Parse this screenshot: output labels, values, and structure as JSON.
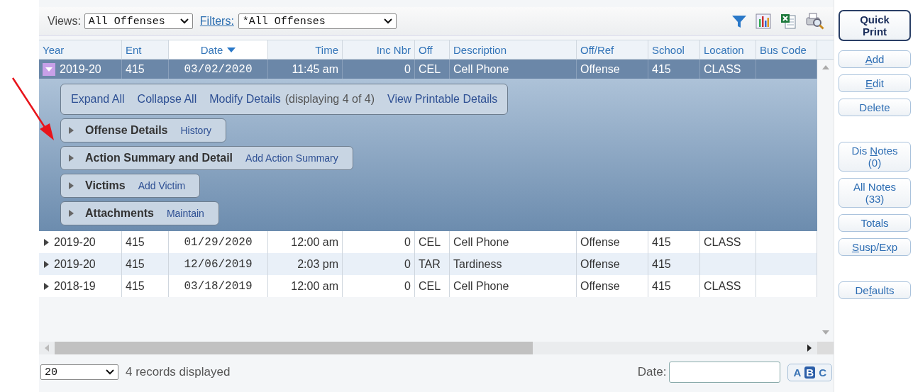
{
  "toolbar": {
    "views_label": "Views:",
    "views_value": "All Offenses",
    "filters_label": "Filters:",
    "filters_value": "*All Offenses"
  },
  "table": {
    "columns": [
      {
        "label": "Year",
        "sorted": false
      },
      {
        "label": "Ent",
        "sorted": false
      },
      {
        "label": "Date",
        "sorted": true
      },
      {
        "label": "Time",
        "sorted": false
      },
      {
        "label": "Inc Nbr",
        "sorted": false
      },
      {
        "label": "Off",
        "sorted": false
      },
      {
        "label": "Description",
        "sorted": false
      },
      {
        "label": "Off/Ref",
        "sorted": false
      },
      {
        "label": "School",
        "sorted": false
      },
      {
        "label": "Location",
        "sorted": false
      },
      {
        "label": "Bus Code",
        "sorted": false
      }
    ],
    "rows": [
      {
        "selected": true,
        "expanded": true,
        "cells": [
          "2019-20",
          "415",
          "03/02/2020",
          "11:45 am",
          "0",
          "CEL",
          "Cell Phone",
          "Offense",
          "415",
          "CLASS"
        ]
      },
      {
        "selected": false,
        "expanded": false,
        "cells": [
          "2019-20",
          "415",
          "01/29/2020",
          "12:00 am",
          "0",
          "CEL",
          "Cell Phone",
          "Offense",
          "415",
          "CLASS"
        ]
      },
      {
        "selected": false,
        "expanded": false,
        "cells": [
          "2019-20",
          "415",
          "12/06/2019",
          "2:03 pm",
          "0",
          "TAR",
          "Tardiness",
          "Offense",
          "415"
        ]
      },
      {
        "selected": false,
        "expanded": false,
        "cells": [
          "2018-19",
          "415",
          "03/18/2019",
          "12:00 am",
          "0",
          "CEL",
          "Cell Phone",
          "Offense",
          "415",
          "CLASS"
        ]
      }
    ],
    "details": {
      "links": [
        {
          "kind": "link",
          "text": "Expand All"
        },
        {
          "kind": "link",
          "text": "Collapse All"
        },
        {
          "kind": "link",
          "text": "Modify Details"
        },
        {
          "kind": "note",
          "text": "(displaying 4 of 4)"
        },
        {
          "kind": "link",
          "text": "View Printable Details"
        }
      ],
      "sections": [
        {
          "title": "Offense Details",
          "action": "History",
          "expanded": false
        },
        {
          "title": "Action Summary and Detail",
          "action": "Add Action Summary",
          "expanded": false
        },
        {
          "title": "Victims",
          "action": "Add Victim",
          "expanded": false
        },
        {
          "title": "Attachments",
          "action": "Maintain",
          "expanded": false
        }
      ]
    }
  },
  "footer": {
    "page_size": "20",
    "records": "4 records displayed",
    "date_label": "Date:",
    "letters": [
      {
        "letter": "A",
        "selected": false
      },
      {
        "letter": "B",
        "selected": true
      },
      {
        "letter": "C",
        "selected": false
      }
    ]
  },
  "side_buttons": [
    [
      {
        "kind": "primary",
        "before": "Quick",
        "line2": "Print"
      }
    ],
    [
      {
        "kind": "normal",
        "key": "A",
        "after": "dd"
      },
      {
        "kind": "normal",
        "key": "E",
        "after": "dit"
      },
      {
        "kind": "normal",
        "before": "Delete"
      }
    ],
    [
      {
        "kind": "normal",
        "before": "Dis ",
        "key": "N",
        "after": "otes",
        "line2": "(0)"
      },
      {
        "kind": "normal",
        "before": "All Notes",
        "line2": "(33)"
      },
      {
        "kind": "normal",
        "before": "Totals"
      },
      {
        "kind": "normal",
        "key": "S",
        "after": "usp/Exp"
      }
    ],
    [
      {
        "kind": "normal",
        "before": "De",
        "key": "f",
        "after": "aults"
      }
    ]
  ]
}
